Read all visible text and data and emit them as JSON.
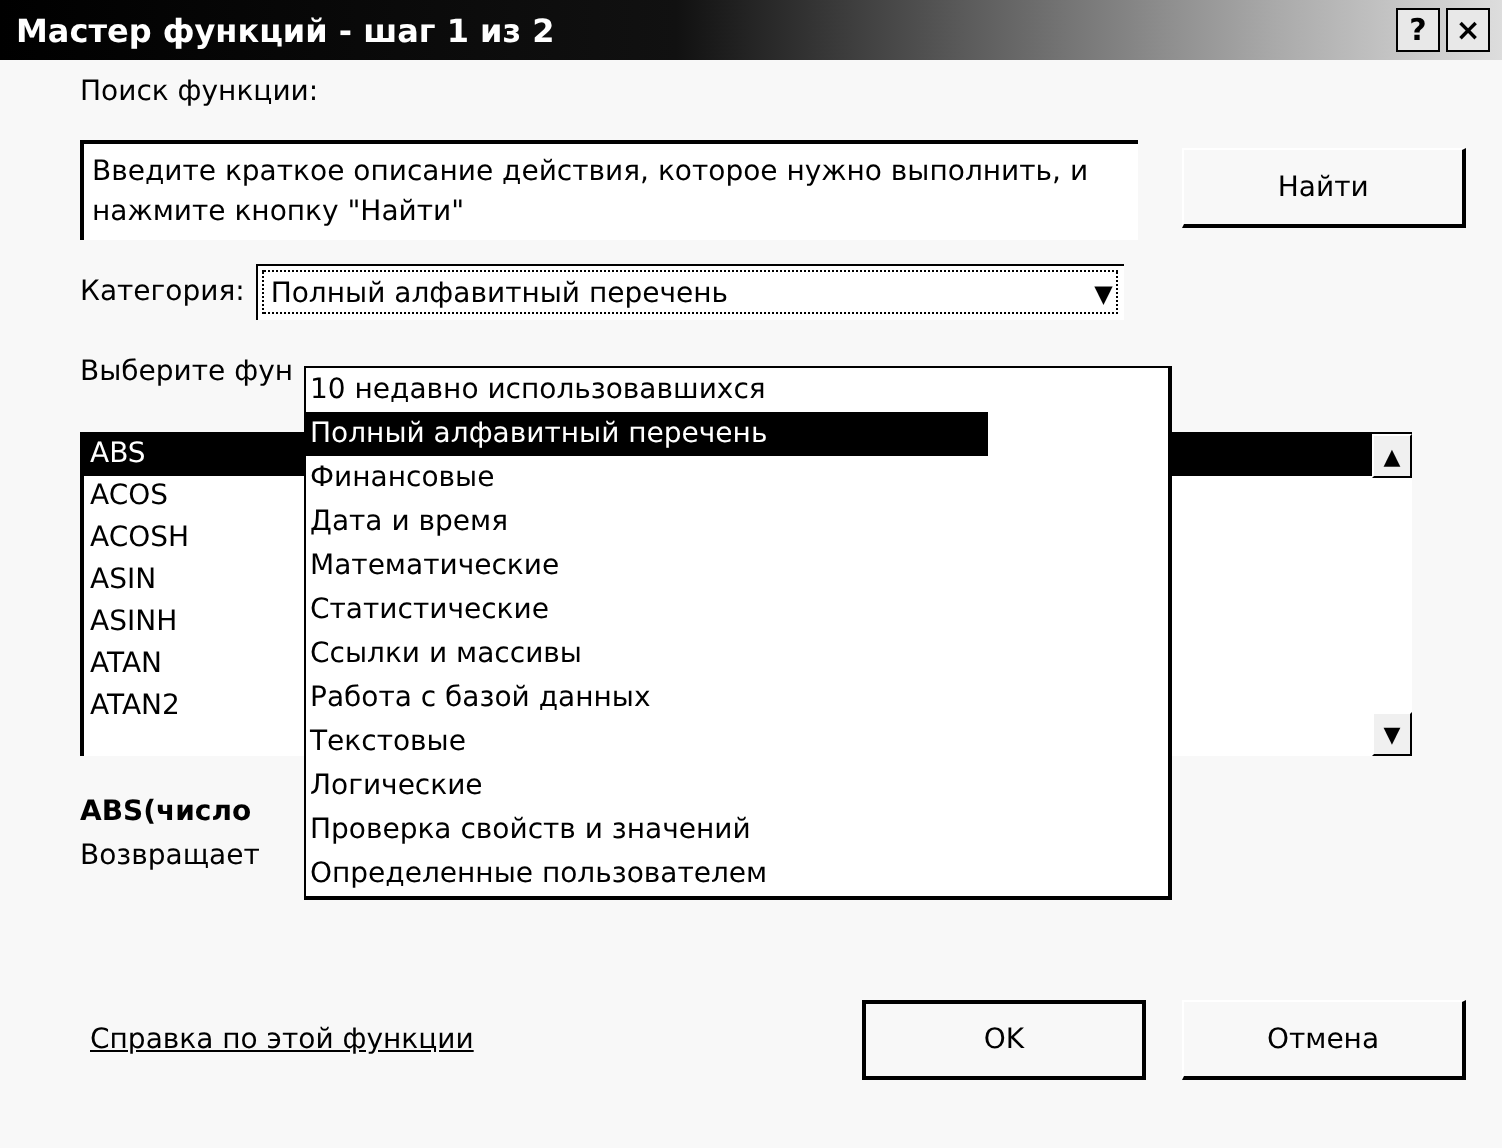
{
  "window": {
    "title": "Мастер функций - шаг 1 из 2",
    "help_button": "?",
    "close_button": "×"
  },
  "search": {
    "label": "Поиск функции:",
    "value": "Введите краткое описание действия, которое нужно выполнить, и нажмите кнопку \"Найти\"",
    "button": "Найти"
  },
  "category": {
    "label": "Категория:",
    "value": "Полный алфавитный перечень",
    "arrow": "▼",
    "expanded": true,
    "options": [
      {
        "label": "10 недавно использовавшихся",
        "selected": false
      },
      {
        "label": "Полный алфавитный перечень",
        "selected": true
      },
      {
        "label": "Финансовые",
        "selected": false
      },
      {
        "label": "Дата и время",
        "selected": false
      },
      {
        "label": "Математические",
        "selected": false
      },
      {
        "label": "Статистические",
        "selected": false
      },
      {
        "label": "Ссылки и массивы",
        "selected": false
      },
      {
        "label": "Работа с базой данных",
        "selected": false
      },
      {
        "label": "Текстовые",
        "selected": false
      },
      {
        "label": "Логические",
        "selected": false
      },
      {
        "label": "Проверка свойств и значений",
        "selected": false
      },
      {
        "label": "Определенные пользователем",
        "selected": false
      }
    ]
  },
  "functions": {
    "label": "Выберите фун",
    "scroll_up": "▲",
    "scroll_down": "▼",
    "items": [
      {
        "label": "ABS",
        "selected": true
      },
      {
        "label": "ACOS",
        "selected": false
      },
      {
        "label": "ACOSH",
        "selected": false
      },
      {
        "label": "ASIN",
        "selected": false
      },
      {
        "label": "ASINH",
        "selected": false
      },
      {
        "label": "ATAN",
        "selected": false
      },
      {
        "label": "ATAN2",
        "selected": false
      }
    ]
  },
  "syntax": "ABS(число",
  "description": "Возвращает",
  "help_link": "Справка по этой функции",
  "buttons": [
    {
      "label": "OK",
      "default": true
    },
    {
      "label": "Отмена",
      "default": false
    }
  ]
}
